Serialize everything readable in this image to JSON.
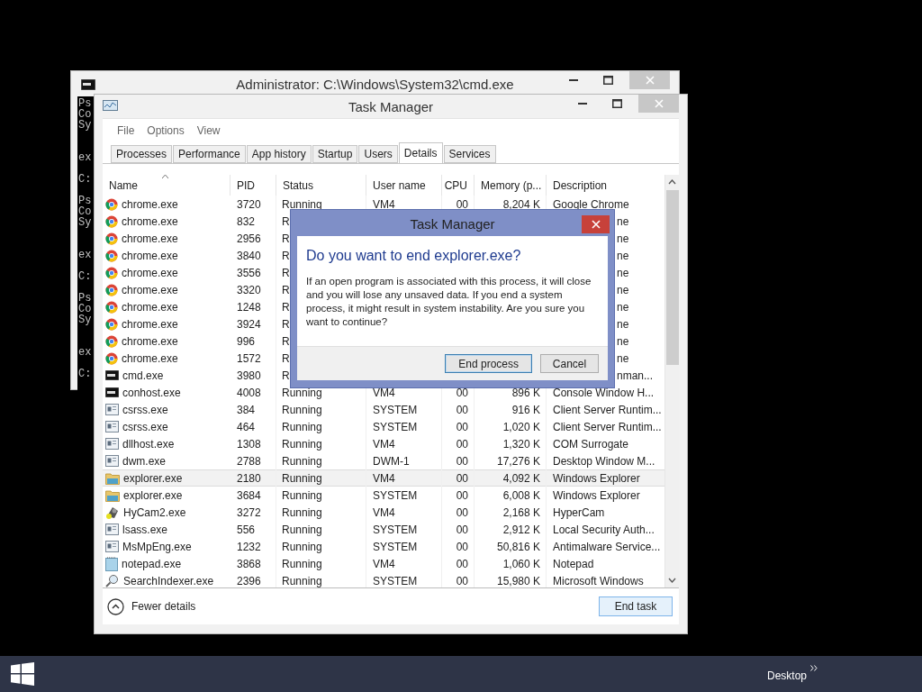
{
  "console_window": {
    "title": "Administrator: C:\\Windows\\System32\\cmd.exe",
    "blocks": [
      {
        "head": [
          "Ps",
          "Co",
          "Sy"
        ],
        "command": "ex",
        "prompt": "C:"
      },
      {
        "head": [
          "Ps",
          "Co",
          "Sy"
        ],
        "command": "ex",
        "prompt": "C:"
      },
      {
        "head": [
          "Ps",
          "Co",
          "Sy"
        ],
        "command": "ex",
        "prompt": "C:"
      }
    ]
  },
  "task_manager": {
    "title": "Task Manager",
    "menu": [
      "File",
      "Options",
      "View"
    ],
    "tabs": [
      {
        "label": "Processes",
        "selected": false
      },
      {
        "label": "Performance",
        "selected": false
      },
      {
        "label": "App history",
        "selected": false
      },
      {
        "label": "Startup",
        "selected": false
      },
      {
        "label": "Users",
        "selected": false
      },
      {
        "label": "Details",
        "selected": true
      },
      {
        "label": "Services",
        "selected": false
      }
    ],
    "table": {
      "columns": [
        "Name",
        "PID",
        "Status",
        "User name",
        "CPU",
        "Memory (p...",
        "Description"
      ],
      "rows": [
        {
          "kind": "chrome",
          "name": "chrome.exe",
          "pid": "3720",
          "status": "Running",
          "user": "VM4",
          "cpu": "00",
          "memory": "8,204 K",
          "description": "Google Chrome",
          "clipped": false,
          "selected": false
        },
        {
          "kind": "chrome",
          "name": "chrome.exe",
          "pid": "832",
          "status": "R",
          "description": "ne",
          "clipped": true,
          "selected": false
        },
        {
          "kind": "chrome",
          "name": "chrome.exe",
          "pid": "2956",
          "status": "R",
          "description": "ne",
          "clipped": true,
          "selected": false
        },
        {
          "kind": "chrome",
          "name": "chrome.exe",
          "pid": "3840",
          "status": "R",
          "description": "ne",
          "clipped": true,
          "selected": false
        },
        {
          "kind": "chrome",
          "name": "chrome.exe",
          "pid": "3556",
          "status": "R",
          "description": "ne",
          "clipped": true,
          "selected": false
        },
        {
          "kind": "chrome",
          "name": "chrome.exe",
          "pid": "3320",
          "status": "R",
          "description": "ne",
          "clipped": true,
          "selected": false
        },
        {
          "kind": "chrome",
          "name": "chrome.exe",
          "pid": "1248",
          "status": "R",
          "description": "ne",
          "clipped": true,
          "selected": false
        },
        {
          "kind": "chrome",
          "name": "chrome.exe",
          "pid": "3924",
          "status": "R",
          "description": "ne",
          "clipped": true,
          "selected": false
        },
        {
          "kind": "chrome",
          "name": "chrome.exe",
          "pid": "996",
          "status": "R",
          "description": "ne",
          "clipped": true,
          "selected": false
        },
        {
          "kind": "chrome",
          "name": "chrome.exe",
          "pid": "1572",
          "status": "R",
          "description": "ne",
          "clipped": true,
          "selected": false
        },
        {
          "kind": "console",
          "name": "cmd.exe",
          "pid": "3980",
          "status": "R",
          "description": "nman...",
          "clipped": true,
          "selected": false
        },
        {
          "kind": "console",
          "name": "conhost.exe",
          "pid": "4008",
          "status": "Running",
          "user": "VM4",
          "cpu": "00",
          "memory": "896 K",
          "description": "Console Window H...",
          "clipped": false,
          "selected": false
        },
        {
          "kind": "app",
          "name": "csrss.exe",
          "pid": "384",
          "status": "Running",
          "user": "SYSTEM",
          "cpu": "00",
          "memory": "916 K",
          "description": "Client Server Runtim...",
          "clipped": false,
          "selected": false
        },
        {
          "kind": "app",
          "name": "csrss.exe",
          "pid": "464",
          "status": "Running",
          "user": "SYSTEM",
          "cpu": "00",
          "memory": "1,020 K",
          "description": "Client Server Runtim...",
          "clipped": false,
          "selected": false
        },
        {
          "kind": "app",
          "name": "dllhost.exe",
          "pid": "1308",
          "status": "Running",
          "user": "VM4",
          "cpu": "00",
          "memory": "1,320 K",
          "description": "COM Surrogate",
          "clipped": false,
          "selected": false
        },
        {
          "kind": "app",
          "name": "dwm.exe",
          "pid": "2788",
          "status": "Running",
          "user": "DWM-1",
          "cpu": "00",
          "memory": "17,276 K",
          "description": "Desktop Window M...",
          "clipped": false,
          "selected": false
        },
        {
          "kind": "folder",
          "name": "explorer.exe",
          "pid": "2180",
          "status": "Running",
          "user": "VM4",
          "cpu": "00",
          "memory": "4,092 K",
          "description": "Windows Explorer",
          "clipped": false,
          "selected": true
        },
        {
          "kind": "folder",
          "name": "explorer.exe",
          "pid": "3684",
          "status": "Running",
          "user": "SYSTEM",
          "cpu": "00",
          "memory": "6,008 K",
          "description": "Windows Explorer",
          "clipped": false,
          "selected": false
        },
        {
          "kind": "camera",
          "name": "HyCam2.exe",
          "pid": "3272",
          "status": "Running",
          "user": "VM4",
          "cpu": "00",
          "memory": "2,168 K",
          "description": "HyperCam",
          "clipped": false,
          "selected": false
        },
        {
          "kind": "app",
          "name": "lsass.exe",
          "pid": "556",
          "status": "Running",
          "user": "SYSTEM",
          "cpu": "00",
          "memory": "2,912 K",
          "description": "Local Security Auth...",
          "clipped": false,
          "selected": false
        },
        {
          "kind": "app",
          "name": "MsMpEng.exe",
          "pid": "1232",
          "status": "Running",
          "user": "SYSTEM",
          "cpu": "00",
          "memory": "50,816 K",
          "description": "Antimalware Service...",
          "clipped": false,
          "selected": false
        },
        {
          "kind": "notepad",
          "name": "notepad.exe",
          "pid": "3868",
          "status": "Running",
          "user": "VM4",
          "cpu": "00",
          "memory": "1,060 K",
          "description": "Notepad",
          "clipped": false,
          "selected": false
        },
        {
          "kind": "search",
          "name": "SearchIndexer.exe",
          "pid": "2396",
          "status": "Running",
          "user": "SYSTEM",
          "cpu": "00",
          "memory": "15,980 K",
          "description": "Microsoft Windows",
          "clipped": false,
          "selected": false
        }
      ]
    },
    "footer": {
      "toggle": "Fewer details",
      "button": "End task"
    }
  },
  "dialog": {
    "title": "Task Manager",
    "heading": "Do you want to end explorer.exe?",
    "message": "If an open program is associated with this process, it will close and you will lose any unsaved data. If you end a system process, it might result in system instability. Are you sure you want to continue?",
    "buttons": [
      {
        "label": "End process",
        "selected": true
      },
      {
        "label": "Cancel",
        "selected": false
      }
    ]
  },
  "taskbar": {
    "toolbar": "Desktop"
  }
}
